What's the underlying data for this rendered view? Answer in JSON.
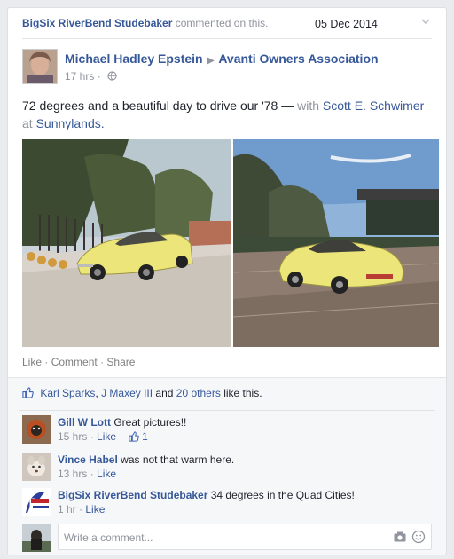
{
  "story": {
    "actor": "BigSix RiverBend Studebaker",
    "verb": "commented on this.",
    "date": "05 Dec 2014"
  },
  "post": {
    "author": "Michael Hadley Epstein",
    "group": "Avanti Owners Association",
    "time": "17 hrs",
    "text": "72 degrees and a beautiful day to drive our '78 —",
    "with_label": "with",
    "tagged_person": "Scott E. Schwimer",
    "at_label": "at",
    "place": "Sunnylands."
  },
  "actions": {
    "like": "Like",
    "dot1": "·",
    "comment": "Comment",
    "dot2": "·",
    "share": "Share"
  },
  "likes": {
    "name1": "Karl Sparks",
    "comma": ",",
    "name2": "J Maxey III",
    "and": "and",
    "others": "20 others",
    "suffix": "like this."
  },
  "comments": [
    {
      "name": "Gill W Lott",
      "text": "Great pictures!!",
      "time": "15 hrs",
      "like": "Like",
      "like_count": "1"
    },
    {
      "name": "Vince Habel",
      "text": "was not that warm here.",
      "time": "13 hrs",
      "like": "Like"
    },
    {
      "name": "BigSix RiverBend Studebaker",
      "text": "34 degrees in the Quad Cities!",
      "time": "1 hr",
      "like": "Like"
    }
  ],
  "meta_dot": "·",
  "composer": {
    "placeholder": "Write a comment..."
  },
  "colors": {
    "link": "#365899",
    "muted": "#90949c",
    "ufi_bg": "#f6f7f9",
    "car": "#ece67a"
  }
}
